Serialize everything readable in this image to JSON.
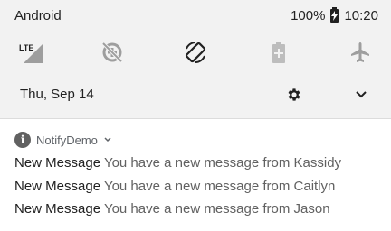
{
  "status": {
    "carrier": "Android",
    "battery": "100%",
    "time": "10:20"
  },
  "quick_settings": [
    {
      "name": "lte-signal",
      "label": "LTE"
    },
    {
      "name": "data-saver",
      "label": ""
    },
    {
      "name": "auto-rotate",
      "label": ""
    },
    {
      "name": "battery-saver",
      "label": ""
    },
    {
      "name": "airplane-mode",
      "label": ""
    }
  ],
  "date_row": {
    "date": "Thu, Sep 14"
  },
  "notification": {
    "app_name": "NotifyDemo",
    "app_icon_glyph": "i",
    "messages": [
      {
        "title": "New Message",
        "body": "You have a new message from Kassidy"
      },
      {
        "title": "New Message",
        "body": "You have a new message from Caitlyn"
      },
      {
        "title": "New Message",
        "body": "You have a new message from Jason"
      }
    ]
  }
}
